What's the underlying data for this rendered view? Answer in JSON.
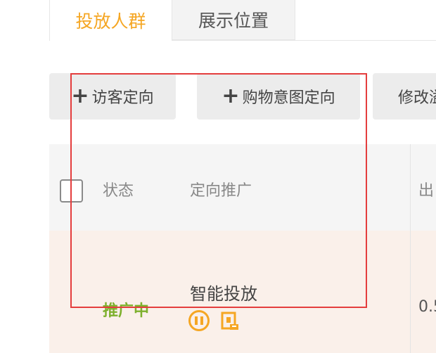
{
  "tabs": [
    {
      "label": "投放人群",
      "active": true
    },
    {
      "label": "展示位置",
      "active": false
    }
  ],
  "toolbar": {
    "visitor_targeting": "访客定向",
    "shopping_intent": "购物意图定向",
    "modify": "修改溢"
  },
  "table": {
    "headers": {
      "status": "状态",
      "targeting": "定向推广",
      "exposure": "出"
    },
    "rows": [
      {
        "status": "推广中",
        "name": "智能投放",
        "value": "0.5"
      }
    ]
  },
  "colors": {
    "accent": "#f5a623",
    "status_active": "#7db02d",
    "row_highlight": "#faf0ea",
    "selection_outline": "#e43d3d"
  },
  "icons": {
    "pause": "pause-circle-icon",
    "report": "report-icon"
  }
}
